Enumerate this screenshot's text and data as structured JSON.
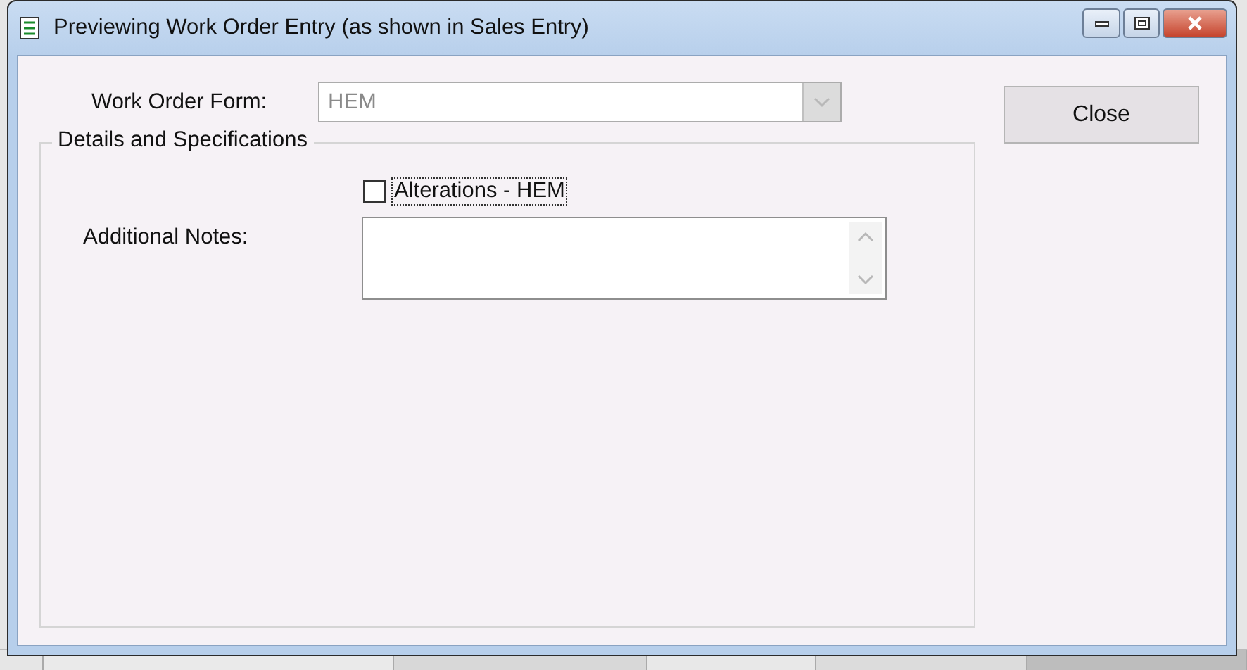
{
  "window": {
    "title": "Previewing Work Order Entry (as shown in Sales Entry)"
  },
  "work_order_form": {
    "label": "Work Order Form:",
    "value": "HEM",
    "disabled": true
  },
  "close_button": "Close",
  "details": {
    "title": "Details and Specifications",
    "checkbox": {
      "label": "Alterations - HEM",
      "checked": false,
      "focused": true
    },
    "notes": {
      "label": "Additional Notes:"
    }
  }
}
